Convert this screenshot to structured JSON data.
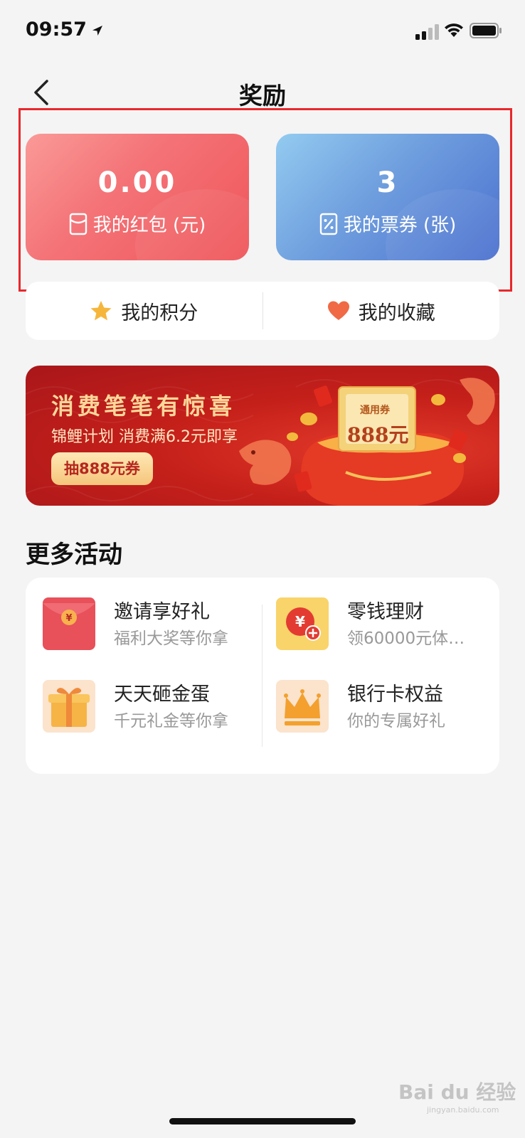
{
  "status_bar": {
    "time": "09:57"
  },
  "nav": {
    "title": "奖励"
  },
  "cards": {
    "red_envelope": {
      "value": "0.00",
      "label": "我的红包 (元)"
    },
    "vouchers": {
      "value": "3",
      "label": "我的票券 (张)"
    }
  },
  "quick_links": {
    "points": "我的积分",
    "favorites": "我的收藏"
  },
  "banner": {
    "title": "消费笔笔有惊喜",
    "subtitle": "锦鲤计划 消费满6.2元即享",
    "button": "抽888元券",
    "ticket_label": "通用券",
    "ticket_amount": "888元"
  },
  "more_activities": {
    "title": "更多活动",
    "items": [
      {
        "title": "邀请享好礼",
        "subtitle": "福利大奖等你拿"
      },
      {
        "title": "零钱理财",
        "subtitle": "领60000元体…"
      },
      {
        "title": "天天砸金蛋",
        "subtitle": "千元礼金等你拿"
      },
      {
        "title": "银行卡权益",
        "subtitle": "你的专属好礼"
      }
    ]
  },
  "watermark": {
    "text": "Bai du 经验",
    "sub": "jingyan.baidu.com"
  },
  "colors": {
    "highlight": "#e8282c",
    "card_red": "#f47478",
    "card_blue": "#4a70cf",
    "banner_red": "#c5201a"
  }
}
